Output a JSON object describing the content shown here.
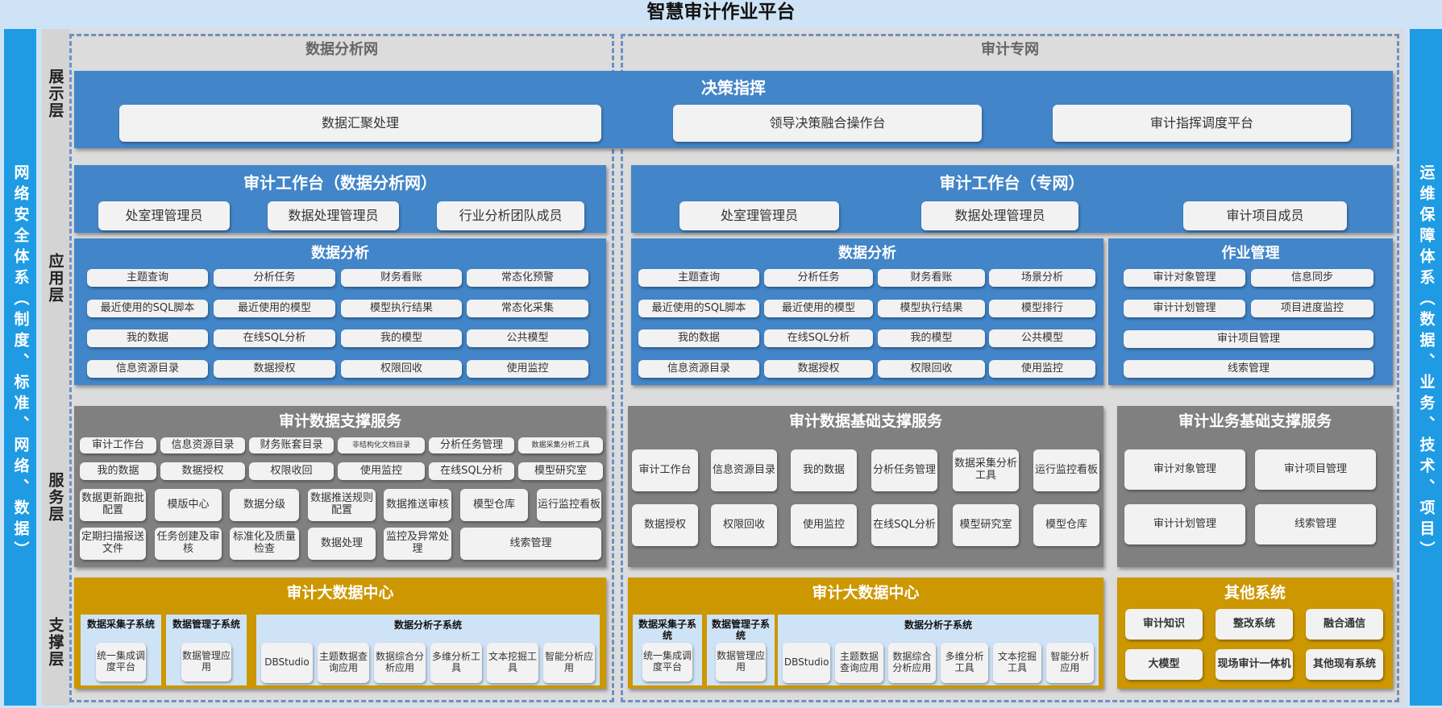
{
  "title": "智慧审计作业平台",
  "left_side": "网络安全体系（制度、标准、网络、数据）",
  "right_side": "运维保障体系（数据、业务、技术、项目）",
  "networks": {
    "left": "数据分析网",
    "right": "审计专网"
  },
  "layers": {
    "display": "展示层",
    "app": "应用层",
    "service": "服务层",
    "support": "支撑层"
  },
  "display": {
    "title": "决策指挥",
    "items": [
      "数据汇聚处理",
      "领导决策融合操作台",
      "审计指挥调度平台"
    ]
  },
  "app_left": {
    "title": "审计工作台（数据分析网）",
    "roles": [
      "处室理管理员",
      "数据处理管理员",
      "行业分析团队成员"
    ],
    "analysis_title": "数据分析",
    "analysis": [
      [
        "主题查询",
        "分析任务",
        "财务看账",
        "常态化预警"
      ],
      [
        "最近使用的SQL脚本",
        "最近使用的模型",
        "模型执行结果",
        "常态化采集"
      ],
      [
        "我的数据",
        "在线SQL分析",
        "我的模型",
        "公共模型"
      ],
      [
        "信息资源目录",
        "数据授权",
        "权限回收",
        "使用监控"
      ]
    ]
  },
  "app_right": {
    "title": "审计工作台（专网）",
    "roles": [
      "处室理管理员",
      "数据处理管理员",
      "审计项目成员"
    ],
    "analysis_title": "数据分析",
    "analysis": [
      [
        "主题查询",
        "分析任务",
        "财务看账",
        "场景分析"
      ],
      [
        "最近使用的SQL脚本",
        "最近使用的模型",
        "模型执行结果",
        "模型排行"
      ],
      [
        "我的数据",
        "在线SQL分析",
        "我的模型",
        "公共模型"
      ],
      [
        "信息资源目录",
        "数据授权",
        "权限回收",
        "使用监控"
      ]
    ],
    "job_title": "作业管理",
    "job": [
      "审计对象管理",
      "信息同步",
      "审计计划管理",
      "项目进度监控",
      "审计项目管理",
      "线索管理"
    ]
  },
  "svc_left": {
    "title": "审计数据支撑服务",
    "row1": [
      "审计工作台",
      "信息资源目录",
      "财务账套目录",
      "非结构化文档目录",
      "分析任务管理",
      "数据采集分析工具"
    ],
    "row2": [
      "我的数据",
      "数据授权",
      "权限收回",
      "使用监控",
      "在线SQL分析",
      "模型研究室"
    ],
    "row3": [
      "数据更新跑批配置",
      "模版中心",
      "数据分级",
      "数据推送规则配置",
      "数据推送审核",
      "模型仓库",
      "运行监控看板"
    ],
    "row4": [
      "定期扫描报送文件",
      "任务创建及审核",
      "标准化及质量检查",
      "数据处理",
      "监控及异常处理",
      "线索管理"
    ]
  },
  "svc_mid": {
    "title": "审计数据基础支撑服务",
    "row1": [
      "审计工作台",
      "信息资源目录",
      "我的数据",
      "分析任务管理",
      "数据采集分析工具",
      "运行监控看板"
    ],
    "row2": [
      "数据授权",
      "权限回收",
      "使用监控",
      "在线SQL分析",
      "模型研究室",
      "模型仓库"
    ]
  },
  "svc_right": {
    "title": "审计业务基础支撑服务",
    "items": [
      "审计对象管理",
      "审计项目管理",
      "审计计划管理",
      "线索管理"
    ]
  },
  "sup_left": {
    "title": "审计大数据中心",
    "collect_title": "数据采集子系统",
    "collect": [
      "统一集成调度平台"
    ],
    "manage_title": "数据管理子系统",
    "manage": [
      "数据管理应用"
    ],
    "analysis_title": "数据分析子系统",
    "analysis": [
      "DBStudio",
      "主题数据查询应用",
      "数据综合分析应用",
      "多维分析工具",
      "文本挖掘工具",
      "智能分析应用"
    ]
  },
  "sup_mid": {
    "title": "审计大数据中心",
    "collect_title": "数据采集子系统",
    "collect": [
      "统一集成调度平台"
    ],
    "manage_title": "数据管理子系统",
    "manage": [
      "数据管理应用"
    ],
    "analysis_title": "数据分析子系统",
    "analysis": [
      "DBStudio",
      "主题数据查询应用",
      "数据综合分析应用",
      "多维分析工具",
      "文本挖掘工具",
      "智能分析应用"
    ]
  },
  "sup_right": {
    "title": "其他系统",
    "items": [
      "审计知识",
      "整改系统",
      "融合通信",
      "大模型",
      "现场审计一体机",
      "其他现有系统"
    ]
  }
}
